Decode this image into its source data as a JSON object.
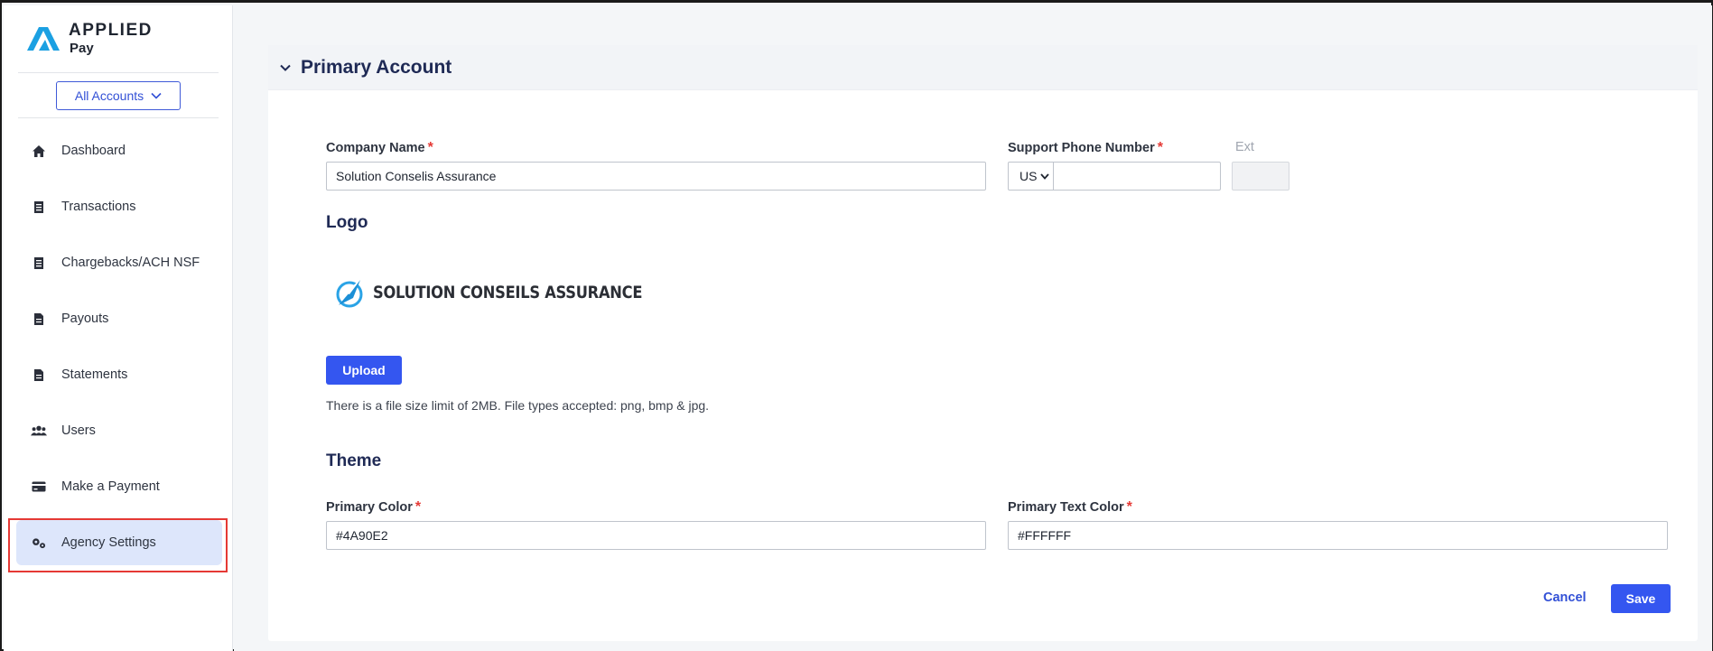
{
  "brand": {
    "line1": "APPLIED",
    "line2": "Pay",
    "accent_color": "#1ba0e2"
  },
  "account_selector": {
    "label": "All Accounts"
  },
  "sidebar": {
    "items": [
      {
        "label": "Dashboard",
        "icon": "home-icon"
      },
      {
        "label": "Transactions",
        "icon": "receipt-icon"
      },
      {
        "label": "Chargebacks/ACH NSF",
        "icon": "receipt-icon"
      },
      {
        "label": "Payouts",
        "icon": "document-icon"
      },
      {
        "label": "Statements",
        "icon": "document-icon"
      },
      {
        "label": "Users",
        "icon": "users-icon"
      },
      {
        "label": "Make a Payment",
        "icon": "credit-card-icon"
      },
      {
        "label": "Agency Settings",
        "icon": "gears-icon",
        "active": true
      }
    ]
  },
  "card": {
    "title": "Primary Account"
  },
  "form": {
    "company_name_label": "Company Name",
    "company_name_value": "Solution Conselis Assurance",
    "support_phone_label": "Support Phone Number",
    "country_code": "US",
    "phone_value": "",
    "ext_label": "Ext",
    "ext_value": "",
    "required_mark": "*"
  },
  "logo": {
    "section_title": "Logo",
    "image_text": "SOLUTION CONSEILS ASSURANCE",
    "upload_label": "Upload",
    "help_text": "There is a file size limit of 2MB. File types accepted: png, bmp & jpg."
  },
  "theme": {
    "section_title": "Theme",
    "primary_color_label": "Primary Color",
    "primary_color_value": "#4A90E2",
    "primary_text_color_label": "Primary Text Color",
    "primary_text_color_value": "#FFFFFF"
  },
  "actions": {
    "cancel_label": "Cancel",
    "save_label": "Save"
  },
  "colors": {
    "primary_button": "#3456f0",
    "link": "#3250d6",
    "required": "#e53935",
    "active_nav_bg": "#dde6fb"
  }
}
